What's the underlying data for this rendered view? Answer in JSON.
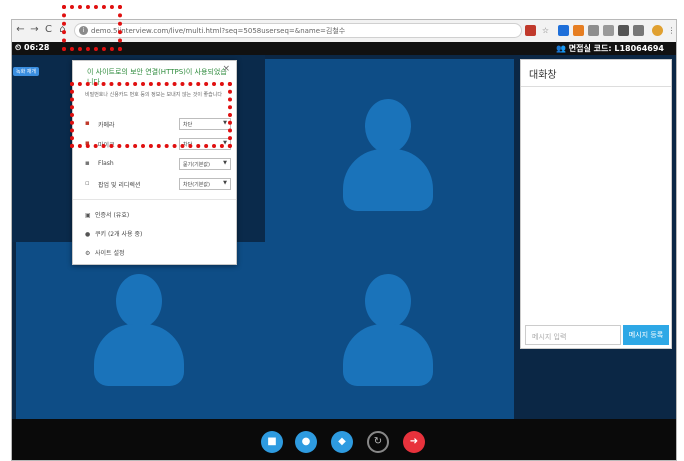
{
  "browser": {
    "url": "demo.5iinterview.com/live/multi.html?seq=5058userseq=&name=김철수",
    "nav_back": "←",
    "nav_forward": "→",
    "nav_reload": "C",
    "nav_home": "⌂",
    "lock_glyph": "i"
  },
  "app": {
    "timer": "06:28",
    "timer_icon": "clock-icon",
    "interview_code_label": "면접실 코드: L18064694",
    "tag_button": "녹화 재개"
  },
  "popup": {
    "title": "이 사이트로의 보안 연결(HTTPS)이 사용되었습니다",
    "close": "×",
    "description": "비밀번호나 신용카드 번호 등의 정보는 보내지 않는 것이 좋습니다",
    "permissions": [
      {
        "label": "카메라",
        "value": "차단",
        "icon": "camera-icon"
      },
      {
        "label": "마이크",
        "value": "차단",
        "icon": "microphone-icon"
      },
      {
        "label": "Flash",
        "value": "묻기(기본값)",
        "icon": "puzzle-icon"
      },
      {
        "label": "팝업 및 리디렉션",
        "value": "차단(기본값)",
        "icon": "popup-icon"
      }
    ],
    "links": [
      {
        "label": "인증서 (유효)",
        "icon": "certificate-icon"
      },
      {
        "label": "쿠키 (2개 사용 중)",
        "icon": "cookie-icon"
      },
      {
        "label": "사이트 설정",
        "icon": "gear-icon"
      }
    ]
  },
  "chat": {
    "title": "대화창",
    "input_placeholder": "메시지 입력",
    "send_label": "메시지 등록"
  },
  "controls": [
    {
      "name": "camera",
      "icon": "video-camera-icon",
      "color": "#2e9be0"
    },
    {
      "name": "mic",
      "icon": "microphone-icon",
      "color": "#2e9be0"
    },
    {
      "name": "chat",
      "icon": "chat-bubbles-icon",
      "color": "#2e9be0"
    },
    {
      "name": "refresh",
      "icon": "refresh-icon",
      "color": "#0a0a0a"
    },
    {
      "name": "exit",
      "icon": "exit-icon",
      "color": "#e8323c"
    }
  ],
  "colors": {
    "accent": "#2ea8e6",
    "tile": "#0e4d86",
    "avatar": "#1a73ba",
    "highlight": "#e01010",
    "secure_green": "#2e8b3c"
  }
}
